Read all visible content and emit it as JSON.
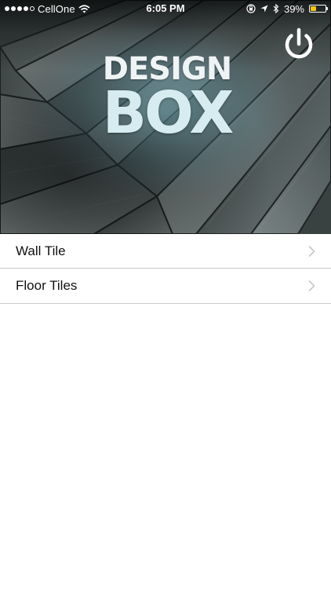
{
  "status_bar": {
    "carrier": "CellOne",
    "time": "6:05 PM",
    "battery_percent": "39%",
    "battery_level": 0.39,
    "signal_bars_filled": 4,
    "signal_bars_total": 5,
    "icons": [
      "wifi-icon",
      "lock-rotation-icon",
      "location-arrow-icon",
      "bluetooth-icon",
      "battery-icon"
    ],
    "battery_color": "#f5c518"
  },
  "hero": {
    "logo_top": "DESIGN",
    "logo_bottom": "BOX",
    "power_icon": "power-icon"
  },
  "menu": {
    "items": [
      {
        "label": "Wall Tile",
        "icon": "chevron-right-icon"
      },
      {
        "label": "Floor Tiles",
        "icon": "chevron-right-icon"
      }
    ]
  },
  "colors": {
    "separator": "#c8c7cc",
    "chevron": "#c7c7cc",
    "logo_accent": "#d7ecf0"
  }
}
